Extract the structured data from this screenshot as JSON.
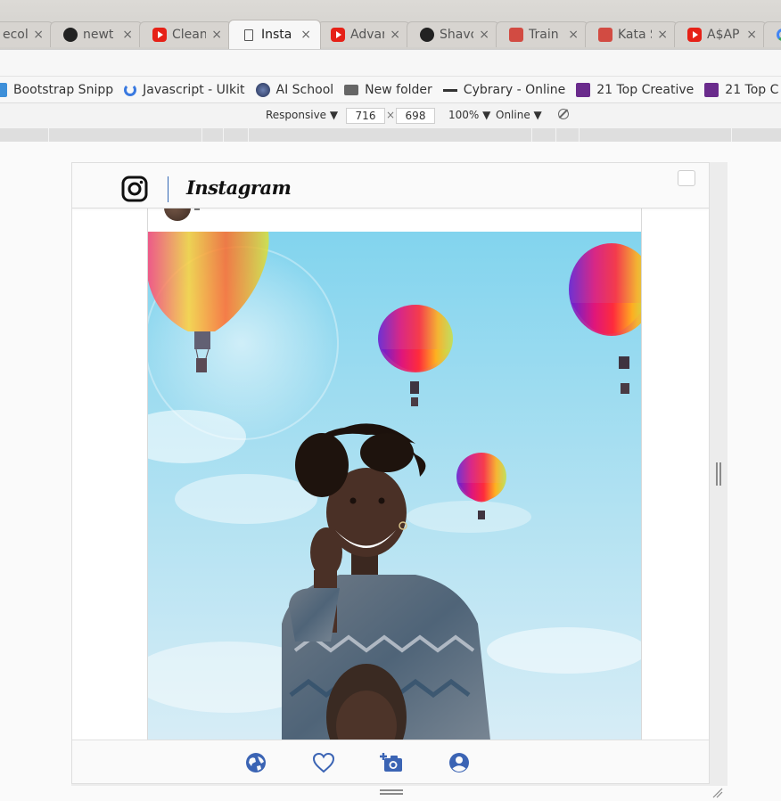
{
  "tabs": [
    {
      "title": "ecoll",
      "icon": "blank-icon",
      "active": false
    },
    {
      "title": "newt",
      "icon": "github-icon",
      "active": false
    },
    {
      "title": "Clean",
      "icon": "youtube-icon",
      "active": false
    },
    {
      "title": "Insta",
      "icon": "document-icon",
      "active": true
    },
    {
      "title": "Advar",
      "icon": "youtube-icon",
      "active": false
    },
    {
      "title": "Shavo",
      "icon": "github-icon",
      "active": false
    },
    {
      "title": "Train",
      "icon": "codewars-icon",
      "active": false
    },
    {
      "title": "Kata S",
      "icon": "codewars-icon",
      "active": false
    },
    {
      "title": "A$AP",
      "icon": "youtube-icon",
      "active": false
    }
  ],
  "tab_close_glyph": "×",
  "bookmarks": [
    {
      "label": "Bootstrap Snipp",
      "icon": "bootstrap-icon"
    },
    {
      "label": "Javascript - UIkit",
      "icon": "uikit-icon"
    },
    {
      "label": "AI School",
      "icon": "ai-school-icon"
    },
    {
      "label": "New folder",
      "icon": "folder-icon"
    },
    {
      "label": "Cybrary - Online",
      "icon": "cybrary-icon"
    },
    {
      "label": "21 Top Creative",
      "icon": "colorlib-icon"
    },
    {
      "label": "21 Top C",
      "icon": "colorlib-icon"
    }
  ],
  "device_toolbar": {
    "device": "Responsive",
    "width": "716",
    "times": "×",
    "height": "698",
    "zoom": "100%",
    "network": "Online",
    "caret": "▼"
  },
  "app": {
    "name": "Instagram",
    "colors": {
      "accent": "#3b64b4",
      "divider": "#3367b5"
    },
    "nav_items": [
      {
        "name": "explore",
        "icon": "globe-icon"
      },
      {
        "name": "likes",
        "icon": "heart-icon"
      },
      {
        "name": "add-photo",
        "icon": "add-camera-icon"
      },
      {
        "name": "profile",
        "icon": "user-circle-icon"
      }
    ]
  }
}
